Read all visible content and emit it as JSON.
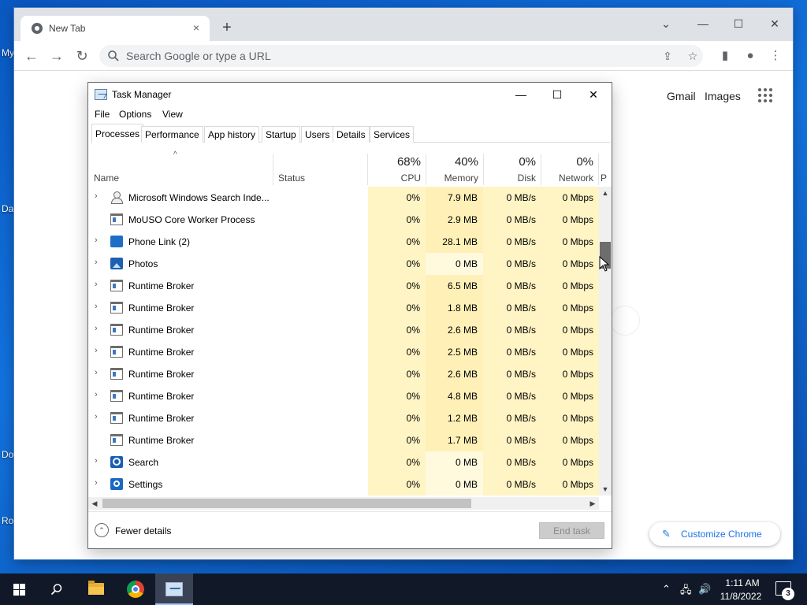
{
  "desktop": {
    "fragments": [
      "My",
      "Da",
      "Do",
      "Ro"
    ]
  },
  "chrome": {
    "tab_title": "New Tab",
    "tab_close": "×",
    "new_tab": "+",
    "window_controls": {
      "tab_search": "⌄",
      "minimize": "—",
      "maximize": "☐",
      "close": "✕"
    },
    "nav": {
      "back": "←",
      "forward": "→",
      "reload": "↻"
    },
    "omnibox_placeholder": "Search Google or type a URL",
    "icons": {
      "share": "⇪",
      "star": "☆",
      "sidebar": "▮",
      "profile": "●",
      "menu": "⋮"
    },
    "ntp": {
      "gmail": "Gmail",
      "images": "Images",
      "customize": "Customize Chrome",
      "pencil": "✎"
    }
  },
  "taskmgr": {
    "title": "Task Manager",
    "window_controls": {
      "minimize": "—",
      "maximize": "☐",
      "close": "✕"
    },
    "menu": [
      "File",
      "Options",
      "View"
    ],
    "tabs": [
      "Processes",
      "Performance",
      "App history",
      "Startup",
      "Users",
      "Details",
      "Services"
    ],
    "active_tab": "Processes",
    "sort_caret": "^",
    "columns": {
      "name": "Name",
      "status": "Status",
      "cpu": {
        "pct": "68%",
        "label": "CPU"
      },
      "memory": {
        "pct": "40%",
        "label": "Memory"
      },
      "disk": {
        "pct": "0%",
        "label": "Disk"
      },
      "network": {
        "pct": "0%",
        "label": "Network"
      },
      "next": "P"
    },
    "rows": [
      {
        "name": "Microsoft Windows Search Inde...",
        "expand": "›",
        "icon": "user-icon",
        "cpu": "0%",
        "memory": "7.9 MB",
        "disk": "0 MB/s",
        "network": "0 Mbps"
      },
      {
        "name": "MoUSO Core Worker Process",
        "expand": "",
        "icon": "window-icon",
        "cpu": "0%",
        "memory": "2.9 MB",
        "disk": "0 MB/s",
        "network": "0 Mbps"
      },
      {
        "name": "Phone Link (2)",
        "expand": "›",
        "icon": "phone-link-icon",
        "cpu": "0%",
        "memory": "28.1 MB",
        "disk": "0 MB/s",
        "network": "0 Mbps"
      },
      {
        "name": "Photos",
        "expand": "›",
        "icon": "photos-icon",
        "cpu": "0%",
        "memory": "0 MB",
        "disk": "0 MB/s",
        "network": "0 Mbps"
      },
      {
        "name": "Runtime Broker",
        "expand": "›",
        "icon": "window-icon",
        "cpu": "0%",
        "memory": "6.5 MB",
        "disk": "0 MB/s",
        "network": "0 Mbps"
      },
      {
        "name": "Runtime Broker",
        "expand": "›",
        "icon": "window-icon",
        "cpu": "0%",
        "memory": "1.8 MB",
        "disk": "0 MB/s",
        "network": "0 Mbps"
      },
      {
        "name": "Runtime Broker",
        "expand": "›",
        "icon": "window-icon",
        "cpu": "0%",
        "memory": "2.6 MB",
        "disk": "0 MB/s",
        "network": "0 Mbps"
      },
      {
        "name": "Runtime Broker",
        "expand": "›",
        "icon": "window-icon",
        "cpu": "0%",
        "memory": "2.5 MB",
        "disk": "0 MB/s",
        "network": "0 Mbps"
      },
      {
        "name": "Runtime Broker",
        "expand": "›",
        "icon": "window-icon",
        "cpu": "0%",
        "memory": "2.6 MB",
        "disk": "0 MB/s",
        "network": "0 Mbps"
      },
      {
        "name": "Runtime Broker",
        "expand": "›",
        "icon": "window-icon",
        "cpu": "0%",
        "memory": "4.8 MB",
        "disk": "0 MB/s",
        "network": "0 Mbps"
      },
      {
        "name": "Runtime Broker",
        "expand": "›",
        "icon": "window-icon",
        "cpu": "0%",
        "memory": "1.2 MB",
        "disk": "0 MB/s",
        "network": "0 Mbps"
      },
      {
        "name": "Runtime Broker",
        "expand": "",
        "icon": "window-icon",
        "cpu": "0%",
        "memory": "1.7 MB",
        "disk": "0 MB/s",
        "network": "0 Mbps"
      },
      {
        "name": "Search",
        "expand": "›",
        "icon": "search-app-icon",
        "cpu": "0%",
        "memory": "0 MB",
        "disk": "0 MB/s",
        "network": "0 Mbps"
      },
      {
        "name": "Settings",
        "expand": "›",
        "icon": "settings-gear-icon",
        "cpu": "0%",
        "memory": "0 MB",
        "disk": "0 MB/s",
        "network": "0 Mbps"
      }
    ],
    "scroll": {
      "up": "▲",
      "down": "▼",
      "left": "◀",
      "right": "▶"
    },
    "footer": {
      "fewer_icon": "⌃",
      "fewer_details": "Fewer details",
      "end_task": "End task"
    }
  },
  "taskbar": {
    "tray": {
      "chevron": "⌃",
      "network": "🖧",
      "volume": "🔊"
    },
    "time": "1:11 AM",
    "date": "11/8/2022",
    "notifications": "3"
  }
}
